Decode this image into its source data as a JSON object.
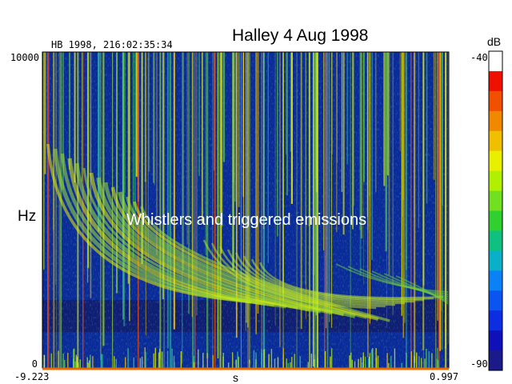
{
  "chart_data": {
    "type": "heatmap",
    "title": "Halley  4 Aug 1998",
    "stamp": "HB 1998, 216:02:35:34",
    "annotation": "Whistlers and triggered emissions",
    "xlabel": "s",
    "ylabel": "Hz",
    "xlim": [
      -9.223,
      0.997
    ],
    "ylim": [
      0,
      10000
    ],
    "x_tick_labels": [
      "-9.223",
      "0.997"
    ],
    "y_tick_labels": [
      "10000",
      "0"
    ],
    "colorbar": {
      "label": "dB",
      "range": [
        -90,
        -40
      ],
      "tick_labels": [
        "-40",
        "-90"
      ],
      "colors": [
        "#1a1a8a",
        "#1010b8",
        "#0c2ee0",
        "#0a55f0",
        "#0a82f5",
        "#0ab0c8",
        "#10c080",
        "#30d030",
        "#70e020",
        "#b0f000",
        "#e8f000",
        "#f0c000",
        "#f08800",
        "#f05000",
        "#f01000",
        "#ffffff"
      ]
    },
    "grid": false,
    "legend": "colorbar-right"
  }
}
